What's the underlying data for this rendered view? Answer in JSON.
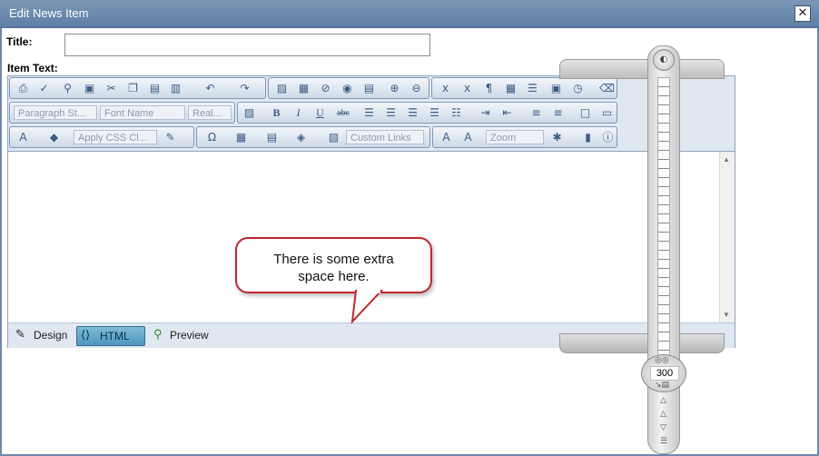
{
  "window": {
    "title": "Edit News Item",
    "close_glyph": "✕"
  },
  "form": {
    "title_label": "Title:",
    "title_value": "",
    "item_text_label": "Item Text:"
  },
  "toolbar": {
    "row1_icons": [
      "print-icon",
      "spellcheck-icon",
      "find-icon",
      "select-all-icon",
      "cut-icon",
      "copy-icon",
      "paste-icon",
      "paste-options-icon",
      "undo-icon",
      "redo-icon",
      "image-manager-icon",
      "document-manager-icon",
      "link-icon",
      "media-icon",
      "template-icon",
      "hyperlink-icon",
      "remove-link-icon",
      "subscript-icon",
      "superscript-icon",
      "paragraph-icon",
      "insert-date-icon",
      "horizontal-rule-icon",
      "snippet-icon",
      "insert-time-icon",
      "format-stripper-icon"
    ],
    "paragraph_style": "Paragraph St...",
    "font_name": "Font Name",
    "font_size": "Real...",
    "css_class": "Apply CSS Cl...",
    "custom_links": "Custom Links",
    "zoom": "Zoom",
    "format_buttons": {
      "bold": "B",
      "italic": "I",
      "underline": "U",
      "strike": "abc"
    }
  },
  "modes": {
    "design": "Design",
    "html": "HTML",
    "preview": "Preview",
    "active": "HTML"
  },
  "callout": {
    "line1": "There is some extra",
    "line2": "space here."
  },
  "ruler": {
    "zoom_value": "300"
  },
  "colors": {
    "titlebar": "#5d7ea4",
    "callout_border": "#c1272d",
    "active_mode": "#4e97bf"
  }
}
